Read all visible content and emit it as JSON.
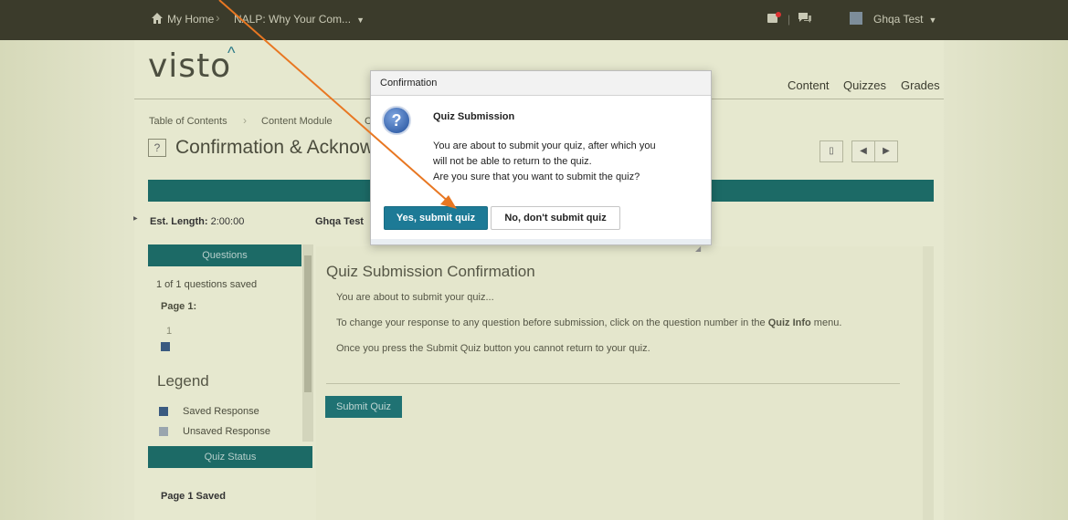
{
  "topbar": {
    "home": "My Home",
    "course": "NALP: Why Your Com...",
    "user": "Ghqa Test"
  },
  "brand": {
    "logo": "visto"
  },
  "nav": {
    "content": "Content",
    "quizzes": "Quizzes",
    "grades": "Grades"
  },
  "breadcrumb": {
    "item1": "Table of Contents",
    "item2": "Content Module",
    "item3_partial": "C"
  },
  "page_title": "Confirmation & Acknow",
  "info": {
    "est_length_label": "Est. Length:",
    "est_length_value": "2:00:00",
    "owner": "Ghqa Test"
  },
  "left_panel": {
    "questions_header": "Questions",
    "saved_count": "1 of 1 questions saved",
    "page_label": "Page 1:",
    "question_number": "1",
    "legend_title": "Legend",
    "legend_saved": "Saved Response",
    "legend_unsaved": "Unsaved Response",
    "quiz_status_header": "Quiz Status",
    "page_status": "Page 1 Saved"
  },
  "main": {
    "heading": "Quiz Submission Confirmation",
    "line1": "You are about to submit your quiz...",
    "line2_prefix": "To change your response to any question before submission, click on the question number in the",
    "line2_bold": "Quiz Info",
    "line2_suffix": "menu.",
    "line3": "Once you press the Submit Quiz button you cannot return to your quiz.",
    "submit_label": "Submit Quiz"
  },
  "modal": {
    "title": "Confirmation",
    "heading": "Quiz Submission",
    "line1": "You are about to submit your quiz, after which you",
    "line2": "will not be able to return to the quiz.",
    "line3": "Are you sure that you want to submit the quiz?",
    "yes_label": "Yes, submit quiz",
    "no_label": "No, don't submit quiz"
  },
  "colors": {
    "teal": "#1c6a66",
    "arrow": "#e87722",
    "primary_button": "#1d7a96"
  }
}
